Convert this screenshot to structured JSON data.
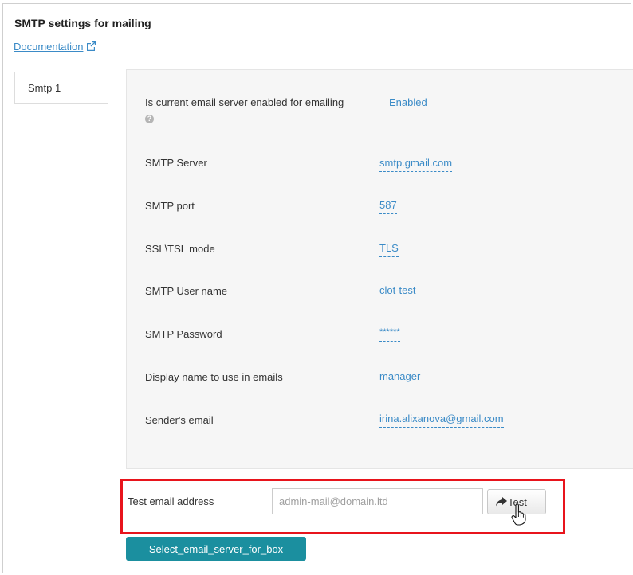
{
  "header": {
    "title": "SMTP settings for mailing",
    "documentation_link": "Documentation"
  },
  "tabs": [
    {
      "label": "Smtp 1",
      "active": true
    }
  ],
  "settings": {
    "rows": [
      {
        "label": "Is current email server enabled for emailing",
        "value": "Enabled"
      },
      {
        "label": "SMTP Server",
        "value": "smtp.gmail.com"
      },
      {
        "label": "SMTP port",
        "value": "587"
      },
      {
        "label": "SSL\\TSL mode",
        "value": "TLS"
      },
      {
        "label": "SMTP User name",
        "value": "clot-test"
      },
      {
        "label": "SMTP Password",
        "value": "******"
      },
      {
        "label": "Display name to use in emails",
        "value": "manager"
      },
      {
        "label": "Sender's email",
        "value": "irina.alixanova@gmail.com"
      }
    ]
  },
  "test": {
    "label": "Test email address",
    "placeholder": "admin-mail@domain.ltd",
    "button_label": "Test"
  },
  "select_server_button": "Select_email_server_for_box",
  "icons": {
    "external_link": "external-link-icon",
    "help": "help-icon",
    "test_arrow": "share-arrow-icon",
    "cursor": "hand-pointer-icon"
  },
  "colors": {
    "link": "#3b8bc7",
    "highlight_border": "#e8141c",
    "primary_button": "#1b8f9f",
    "panel_background": "#f6f6f6"
  }
}
